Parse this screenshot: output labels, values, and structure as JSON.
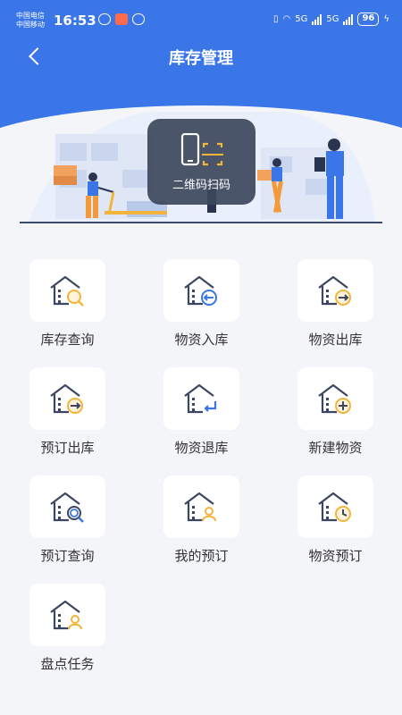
{
  "status_bar": {
    "carrier_line1": "中国电信",
    "carrier_line2": "中国移动",
    "time": "16:53",
    "network_1": "5G",
    "network_2": "5G",
    "battery": "96"
  },
  "nav": {
    "title": "库存管理"
  },
  "scan": {
    "label": "二维码扫码"
  },
  "colors": {
    "primary": "#3a76e8",
    "accent": "#f3b43b",
    "icon_dark": "#3d4660",
    "background": "#f4f5f9"
  },
  "menu": [
    {
      "label": "库存查询",
      "icon": "warehouse-search-icon"
    },
    {
      "label": "物资入库",
      "icon": "warehouse-inbound-icon"
    },
    {
      "label": "物资出库",
      "icon": "warehouse-outbound-icon"
    },
    {
      "label": "预订出库",
      "icon": "reserve-outbound-icon"
    },
    {
      "label": "物资退库",
      "icon": "warehouse-return-icon"
    },
    {
      "label": "新建物资",
      "icon": "warehouse-add-icon"
    },
    {
      "label": "预订查询",
      "icon": "reserve-search-icon"
    },
    {
      "label": "我的预订",
      "icon": "my-reservation-icon"
    },
    {
      "label": "物资预订",
      "icon": "material-reserve-icon"
    },
    {
      "label": "盘点任务",
      "icon": "inventory-task-icon"
    }
  ]
}
